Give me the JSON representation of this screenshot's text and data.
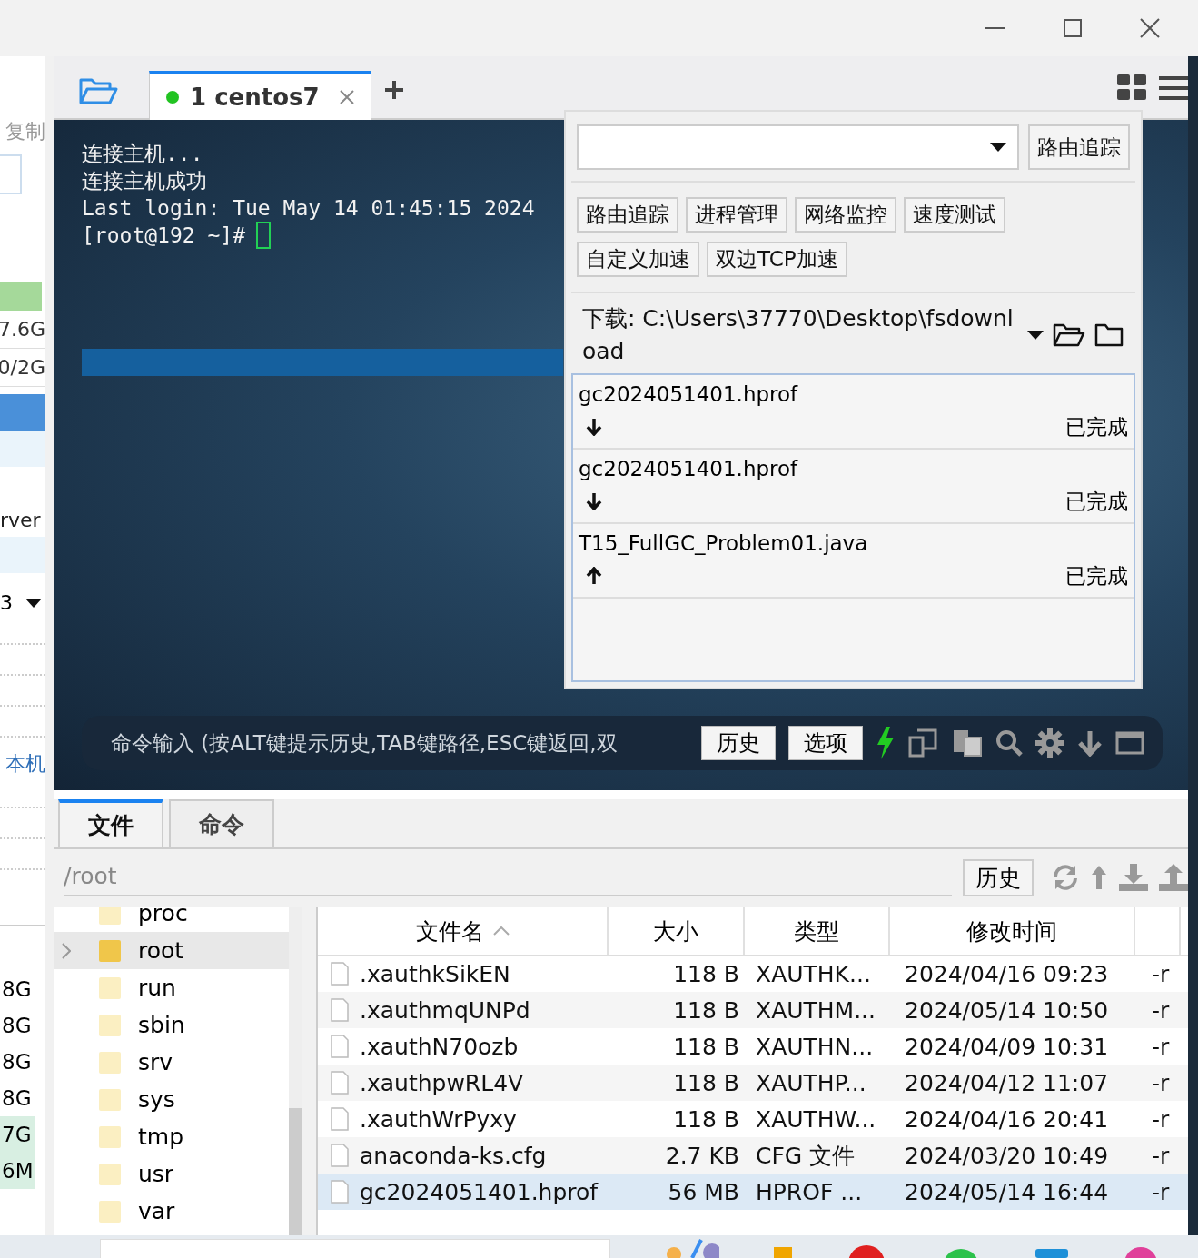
{
  "left_pane": {
    "label": "复制",
    "sizes": [
      "7.6G",
      "0/2G"
    ],
    "name_cut": "rver",
    "dropdown": "3",
    "link": "本机",
    "column_values": [
      {
        "text": "8G",
        "highlight": false
      },
      {
        "text": "8G",
        "highlight": false
      },
      {
        "text": "8G",
        "highlight": false
      },
      {
        "text": "8G",
        "highlight": false
      },
      {
        "text": "7G",
        "highlight": true
      },
      {
        "text": "6M",
        "highlight": true
      }
    ]
  },
  "tabs": [
    {
      "number": "1",
      "label": "centos7",
      "selected": true,
      "connected": true
    }
  ],
  "terminal": {
    "lines": [
      "连接主机...",
      "连接主机成功",
      "Last login: Tue May 14 01:45:15 2024"
    ],
    "prompt": "[root@192 ~]#"
  },
  "tool_panel": {
    "trace_button": "路由追踪",
    "tools": [
      "路由追踪",
      "进程管理",
      "网络监控",
      "速度测试",
      "自定义加速",
      "双边TCP加速"
    ],
    "download_path": "下载: C:\\Users\\37770\\Desktop\\fsdownload",
    "transfers": [
      {
        "name": "gc2024051401.hprof",
        "kind": "download",
        "status": "已完成"
      },
      {
        "name": "gc2024051401.hprof",
        "kind": "download",
        "status": "已完成"
      },
      {
        "name": "T15_FullGC_Problem01.java",
        "kind": "upload",
        "status": "已完成"
      }
    ]
  },
  "command_bar": {
    "placeholder": "命令输入 (按ALT键提示历史,TAB键路径,ESC键返回,双",
    "buttons": [
      "历史",
      "选项"
    ]
  },
  "bottom_tabs": [
    {
      "label": "文件",
      "selected": true
    },
    {
      "label": "命令",
      "selected": false
    }
  ],
  "path": "/root",
  "history_button": "历史",
  "tree": [
    {
      "name": "proc",
      "expandable": false,
      "selected": false
    },
    {
      "name": "root",
      "expandable": true,
      "selected": true
    },
    {
      "name": "run",
      "expandable": false,
      "selected": false
    },
    {
      "name": "sbin",
      "expandable": false,
      "selected": false
    },
    {
      "name": "srv",
      "expandable": false,
      "selected": false
    },
    {
      "name": "sys",
      "expandable": false,
      "selected": false
    },
    {
      "name": "tmp",
      "expandable": false,
      "selected": false
    },
    {
      "name": "usr",
      "expandable": false,
      "selected": false
    },
    {
      "name": "var",
      "expandable": false,
      "selected": false
    }
  ],
  "file_table": {
    "columns": [
      "文件名",
      "大小",
      "类型",
      "修改时间"
    ],
    "rows": [
      {
        "name": ".xauthkSikEN",
        "size": "118 B",
        "type": "XAUTHK...",
        "modified": "2024/04/16 09:23",
        "perm": "-r",
        "selected": false
      },
      {
        "name": ".xauthmqUNPd",
        "size": "118 B",
        "type": "XAUTHM...",
        "modified": "2024/05/14 10:50",
        "perm": "-r",
        "selected": false
      },
      {
        "name": ".xauthN70ozb",
        "size": "118 B",
        "type": "XAUTHN...",
        "modified": "2024/04/09 10:31",
        "perm": "-r",
        "selected": false
      },
      {
        "name": ".xauthpwRL4V",
        "size": "118 B",
        "type": "XAUTHP...",
        "modified": "2024/04/12 11:07",
        "perm": "-r",
        "selected": false
      },
      {
        "name": ".xauthWrPyxy",
        "size": "118 B",
        "type": "XAUTHW...",
        "modified": "2024/04/16 20:41",
        "perm": "-r",
        "selected": false
      },
      {
        "name": "anaconda-ks.cfg",
        "size": "2.7 KB",
        "type": "CFG 文件",
        "modified": "2024/03/20 10:49",
        "perm": "-r",
        "selected": false
      },
      {
        "name": "gc2024051401.hprof",
        "size": "56 MB",
        "type": "HPROF ...",
        "modified": "2024/05/14 16:44",
        "perm": "-r",
        "selected": true
      }
    ]
  }
}
